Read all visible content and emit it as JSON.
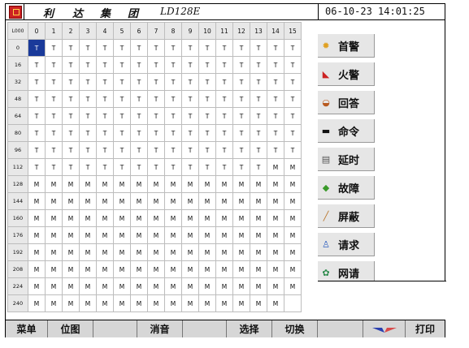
{
  "title": {
    "brand_chars": [
      "利",
      "达",
      "集",
      "团"
    ],
    "model": "LD128E",
    "datetime": "06-10-23 14:01:25"
  },
  "grid": {
    "corner": "L000",
    "col_headers": [
      "0",
      "1",
      "2",
      "3",
      "4",
      "5",
      "6",
      "7",
      "8",
      "9",
      "10",
      "11",
      "12",
      "13",
      "14",
      "15"
    ],
    "rows": [
      {
        "label": "0",
        "cells": [
          "T",
          "T",
          "T",
          "T",
          "T",
          "T",
          "T",
          "T",
          "T",
          "T",
          "T",
          "T",
          "T",
          "T",
          "T",
          "T"
        ]
      },
      {
        "label": "16",
        "cells": [
          "T",
          "T",
          "T",
          "T",
          "T",
          "T",
          "T",
          "T",
          "T",
          "T",
          "T",
          "T",
          "T",
          "T",
          "T",
          "T"
        ]
      },
      {
        "label": "32",
        "cells": [
          "T",
          "T",
          "T",
          "T",
          "T",
          "T",
          "T",
          "T",
          "T",
          "T",
          "T",
          "T",
          "T",
          "T",
          "T",
          "T"
        ]
      },
      {
        "label": "48",
        "cells": [
          "T",
          "T",
          "T",
          "T",
          "T",
          "T",
          "T",
          "T",
          "T",
          "T",
          "T",
          "T",
          "T",
          "T",
          "T",
          "T"
        ]
      },
      {
        "label": "64",
        "cells": [
          "T",
          "T",
          "T",
          "T",
          "T",
          "T",
          "T",
          "T",
          "T",
          "T",
          "T",
          "T",
          "T",
          "T",
          "T",
          "T"
        ]
      },
      {
        "label": "80",
        "cells": [
          "T",
          "T",
          "T",
          "T",
          "T",
          "T",
          "T",
          "T",
          "T",
          "T",
          "T",
          "T",
          "T",
          "T",
          "T",
          "T"
        ]
      },
      {
        "label": "96",
        "cells": [
          "T",
          "T",
          "T",
          "T",
          "T",
          "T",
          "T",
          "T",
          "T",
          "T",
          "T",
          "T",
          "T",
          "T",
          "T",
          "T"
        ]
      },
      {
        "label": "112",
        "cells": [
          "T",
          "T",
          "T",
          "T",
          "T",
          "T",
          "T",
          "T",
          "T",
          "T",
          "T",
          "T",
          "T",
          "T",
          "M",
          "M"
        ]
      },
      {
        "label": "128",
        "cells": [
          "M",
          "M",
          "M",
          "M",
          "M",
          "M",
          "M",
          "M",
          "M",
          "M",
          "M",
          "M",
          "M",
          "M",
          "M",
          "M"
        ]
      },
      {
        "label": "144",
        "cells": [
          "M",
          "M",
          "M",
          "M",
          "M",
          "M",
          "M",
          "M",
          "M",
          "M",
          "M",
          "M",
          "M",
          "M",
          "M",
          "M"
        ]
      },
      {
        "label": "160",
        "cells": [
          "M",
          "M",
          "M",
          "M",
          "M",
          "M",
          "M",
          "M",
          "M",
          "M",
          "M",
          "M",
          "M",
          "M",
          "M",
          "M"
        ]
      },
      {
        "label": "176",
        "cells": [
          "M",
          "M",
          "M",
          "M",
          "M",
          "M",
          "M",
          "M",
          "M",
          "M",
          "M",
          "M",
          "M",
          "M",
          "M",
          "M"
        ]
      },
      {
        "label": "192",
        "cells": [
          "M",
          "M",
          "M",
          "M",
          "M",
          "M",
          "M",
          "M",
          "M",
          "M",
          "M",
          "M",
          "M",
          "M",
          "M",
          "M"
        ]
      },
      {
        "label": "208",
        "cells": [
          "M",
          "M",
          "M",
          "M",
          "M",
          "M",
          "M",
          "M",
          "M",
          "M",
          "M",
          "M",
          "M",
          "M",
          "M",
          "M"
        ]
      },
      {
        "label": "224",
        "cells": [
          "M",
          "M",
          "M",
          "M",
          "M",
          "M",
          "M",
          "M",
          "M",
          "M",
          "M",
          "M",
          "M",
          "M",
          "M",
          "M"
        ]
      },
      {
        "label": "240",
        "cells": [
          "M",
          "M",
          "M",
          "M",
          "M",
          "M",
          "M",
          "M",
          "M",
          "M",
          "M",
          "M",
          "M",
          "M",
          "M",
          ""
        ]
      }
    ],
    "selected_cell": {
      "row": 0,
      "col": 0
    }
  },
  "side_buttons": [
    {
      "label": "首警",
      "icon": "alarm-icon",
      "color": "#e0a020"
    },
    {
      "label": "火警",
      "icon": "fire-icon",
      "color": "#cc2222"
    },
    {
      "label": "回答",
      "icon": "reply-icon",
      "color": "#b85a20"
    },
    {
      "label": "命令",
      "icon": "command-icon",
      "color": "#111111"
    },
    {
      "label": "延时",
      "icon": "delay-icon",
      "color": "#555555"
    },
    {
      "label": "故障",
      "icon": "fault-icon",
      "color": "#3a9a2a"
    },
    {
      "label": "屏蔽",
      "icon": "shield-icon",
      "color": "#b8742a"
    },
    {
      "label": "请求",
      "icon": "request-icon",
      "color": "#3060c0"
    },
    {
      "label": "网请",
      "icon": "network-icon",
      "color": "#2a8a4a"
    }
  ],
  "bottom_bar": {
    "menu": "菜单",
    "position_map": "位图",
    "silence": "消音",
    "select": "选择",
    "switch": "切换",
    "print": "打印"
  },
  "colors": {
    "selected_cell": "#1a3a9a",
    "header_bg": "#e8e8e8",
    "button_bg": "#e6e6e6",
    "bottom_bar_bg": "#d6d6d6"
  }
}
